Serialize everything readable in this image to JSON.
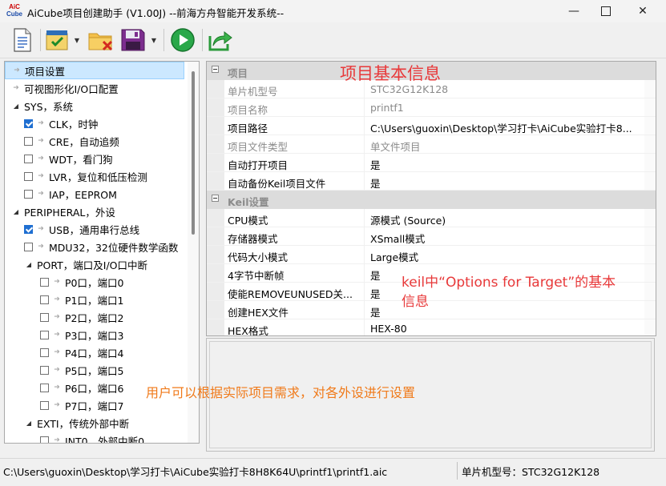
{
  "window": {
    "title": "AiCube项目创建助手 (V1.00J) --前海方舟智能开发系统--",
    "logo_text": [
      "AiC",
      "Cube"
    ]
  },
  "toolbar": {
    "buttons": [
      {
        "name": "new-project-icon"
      },
      {
        "name": "checklist-icon"
      },
      {
        "name": "folder-delete-icon"
      },
      {
        "name": "save-icon"
      },
      {
        "name": "run-icon"
      },
      {
        "name": "export-icon"
      }
    ]
  },
  "tree": {
    "items": [
      {
        "label": "项目设置",
        "depth": 0,
        "kind": "arrow",
        "selected": true
      },
      {
        "label": "可视图形化I/O口配置",
        "depth": 0,
        "kind": "arrow"
      },
      {
        "label": "SYS，系统",
        "depth": 0,
        "kind": "expander"
      },
      {
        "label": "CLK，时钟",
        "depth": 1,
        "kind": "check",
        "checked": true
      },
      {
        "label": "CRE，自动追频",
        "depth": 1,
        "kind": "check",
        "checked": false
      },
      {
        "label": "WDT，看门狗",
        "depth": 1,
        "kind": "check",
        "checked": false
      },
      {
        "label": "LVR，复位和低压检测",
        "depth": 1,
        "kind": "check",
        "checked": false
      },
      {
        "label": "IAP，EEPROM",
        "depth": 1,
        "kind": "check",
        "checked": false
      },
      {
        "label": "PERIPHERAL，外设",
        "depth": 0,
        "kind": "expander"
      },
      {
        "label": "USB，通用串行总线",
        "depth": 1,
        "kind": "check",
        "checked": true
      },
      {
        "label": "MDU32，32位硬件数学函数",
        "depth": 1,
        "kind": "check",
        "checked": false
      },
      {
        "label": "PORT，端口及I/O口中断",
        "depth": 1,
        "kind": "expander"
      },
      {
        "label": "P0口，端口0",
        "depth": 2,
        "kind": "check",
        "checked": false
      },
      {
        "label": "P1口，端口1",
        "depth": 2,
        "kind": "check",
        "checked": false
      },
      {
        "label": "P2口，端口2",
        "depth": 2,
        "kind": "check",
        "checked": false
      },
      {
        "label": "P3口，端口3",
        "depth": 2,
        "kind": "check",
        "checked": false
      },
      {
        "label": "P4口，端口4",
        "depth": 2,
        "kind": "check",
        "checked": false
      },
      {
        "label": "P5口，端口5",
        "depth": 2,
        "kind": "check",
        "checked": false
      },
      {
        "label": "P6口，端口6",
        "depth": 2,
        "kind": "check",
        "checked": false
      },
      {
        "label": "P7口，端口7",
        "depth": 2,
        "kind": "check",
        "checked": false
      },
      {
        "label": "EXTI，传统外部中断",
        "depth": 1,
        "kind": "expander"
      },
      {
        "label": "INT0，外部中断0",
        "depth": 2,
        "kind": "check",
        "checked": false
      }
    ]
  },
  "properties": {
    "categories": [
      {
        "title": "项目",
        "rows": [
          {
            "key": "单片机型号",
            "value": "STC32G12K128",
            "readonly": true
          },
          {
            "key": "项目名称",
            "value": "printf1",
            "readonly": true
          },
          {
            "key": "项目路径",
            "value": "C:\\Users\\guoxin\\Desktop\\学习打卡\\AiCube实验打卡8...",
            "readonly": false
          },
          {
            "key": "项目文件类型",
            "value": "单文件项目",
            "readonly": true
          },
          {
            "key": "自动打开项目",
            "value": "是",
            "readonly": false
          },
          {
            "key": "自动备份Keil项目文件",
            "value": "是",
            "readonly": false
          }
        ]
      },
      {
        "title": "Keil设置",
        "rows": [
          {
            "key": "CPU模式",
            "value": "源模式 (Source)",
            "readonly": false
          },
          {
            "key": "存储器模式",
            "value": "XSmall模式",
            "readonly": false
          },
          {
            "key": "代码大小模式",
            "value": "Large模式",
            "readonly": false
          },
          {
            "key": "4字节中断帧",
            "value": "是",
            "readonly": false
          },
          {
            "key": "使能REMOVEUNUSED关...",
            "value": "是",
            "readonly": false
          },
          {
            "key": "创建HEX文件",
            "value": "是",
            "readonly": false
          },
          {
            "key": "HEX格式",
            "value": "HEX-80",
            "readonly": false
          }
        ]
      }
    ]
  },
  "annotations": {
    "basic_info": "项目基本信息",
    "keil_line1": "keil中“Options for Target”的基本",
    "keil_line2": "信息",
    "user_hint": "用户可以根据实际项目需求，对各外设进行设置"
  },
  "status": {
    "path": "C:\\Users\\guoxin\\Desktop\\学习打卡\\AiCube实验打卡8H8K64U\\printf1\\printf1.aic",
    "chip": "单片机型号：STC32G12K128"
  },
  "colors": {
    "annotation_red": "#e8393a",
    "annotation_orange": "#f07a1a",
    "selection": "#cce8ff",
    "check_blue": "#1f6fd1"
  }
}
